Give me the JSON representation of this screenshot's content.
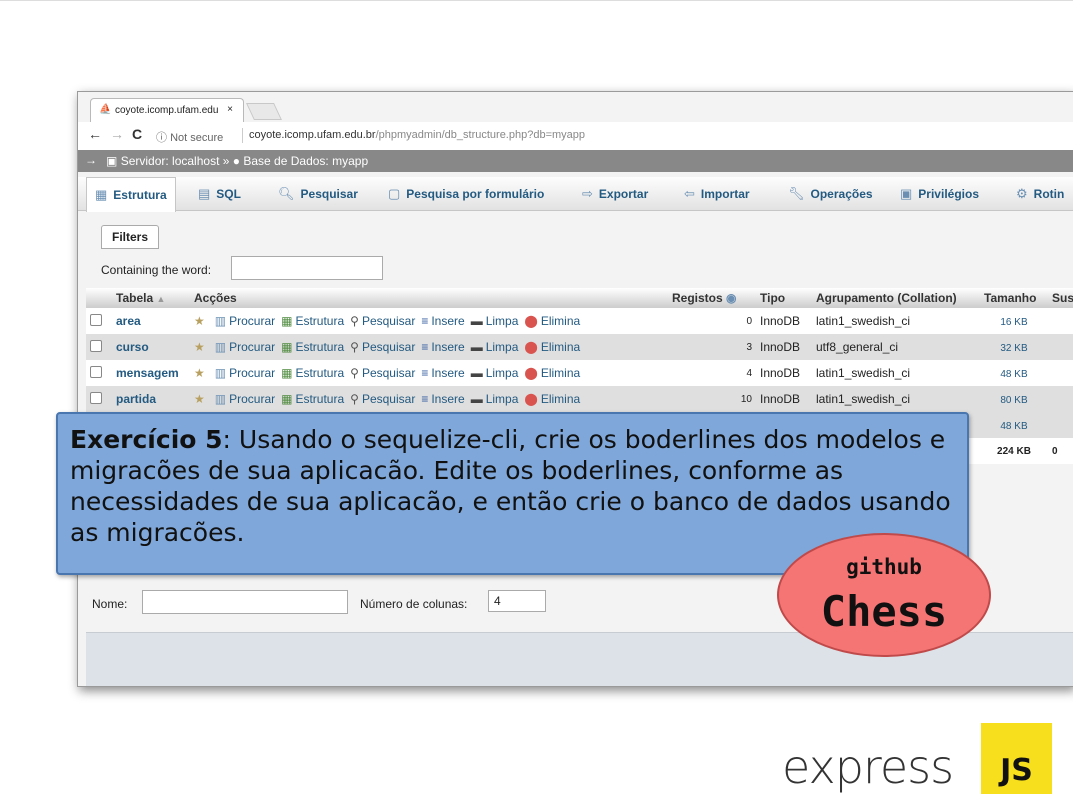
{
  "browser": {
    "tab_title": "coyote.icomp.ufam.edu",
    "tab_close": "×",
    "security": "Not secure",
    "url_host": "coyote.icomp.ufam.edu.br",
    "url_path": "/phpmyadmin/db_structure.php?db=myapp"
  },
  "breadcrumb": {
    "server": "Servidor: localhost",
    "separator": "»",
    "database": "Base de Dados: myapp"
  },
  "menu": [
    {
      "label": "Estrutura",
      "icon": "structure-icon"
    },
    {
      "label": "SQL",
      "icon": "sql-icon"
    },
    {
      "label": "Pesquisar",
      "icon": "search-icon"
    },
    {
      "label": "Pesquisa por formulário",
      "icon": "query-icon"
    },
    {
      "label": "Exportar",
      "icon": "export-icon"
    },
    {
      "label": "Importar",
      "icon": "import-icon"
    },
    {
      "label": "Operações",
      "icon": "wrench-icon"
    },
    {
      "label": "Privilégios",
      "icon": "privileges-icon"
    },
    {
      "label": "Rotin",
      "icon": "routines-icon"
    }
  ],
  "filters": {
    "legend": "Filters",
    "label": "Containing the word:",
    "value": ""
  },
  "table": {
    "headers": {
      "tabela": "Tabela",
      "accoes": "Acções",
      "registos": "Registos",
      "tipo": "Tipo",
      "agrupamento": "Agrupamento (Collation)",
      "tamanho": "Tamanho",
      "susp": "Susp"
    },
    "actions": [
      "Procurar",
      "Estrutura",
      "Pesquisar",
      "Insere",
      "Limpa",
      "Elimina"
    ],
    "rows": [
      {
        "name": "area",
        "rows": "0",
        "type": "InnoDB",
        "collation": "latin1_swedish_ci",
        "size": "16 KB"
      },
      {
        "name": "curso",
        "rows": "3",
        "type": "InnoDB",
        "collation": "utf8_general_ci",
        "size": "32 KB"
      },
      {
        "name": "mensagem",
        "rows": "4",
        "type": "InnoDB",
        "collation": "latin1_swedish_ci",
        "size": "48 KB"
      },
      {
        "name": "partida",
        "rows": "10",
        "type": "InnoDB",
        "collation": "latin1_swedish_ci",
        "size": "80 KB"
      }
    ],
    "hidden_row_size": "48 KB",
    "total_size": "224 KB",
    "total_overhead": "0"
  },
  "create_table": {
    "name_label": "Nome:",
    "name_value": "",
    "columns_label": "Número de colunas:",
    "columns_value": "4"
  },
  "callout": {
    "title": "Exercício 5",
    "text": ": Usando o sequelize-cli, crie os boderlines dos modelos e migracões de sua aplicacão. Edite os boderlines, conforme as necessidades de sua aplicacão, e então crie o banco de dados usando as migracões."
  },
  "badge": {
    "line1": "github",
    "line2": "Chess"
  },
  "logo": {
    "word": "express",
    "js": "JS"
  }
}
